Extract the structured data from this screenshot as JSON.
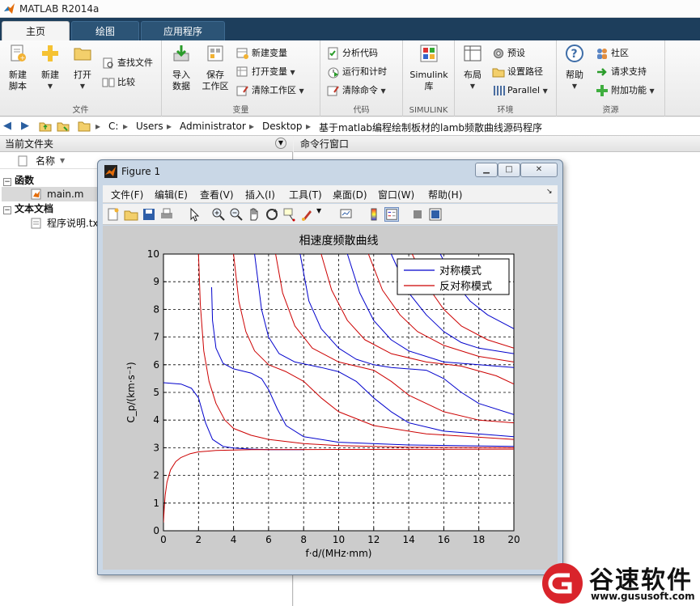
{
  "window": {
    "title": "MATLAB R2014a"
  },
  "tabs": [
    {
      "label": "主页",
      "active": true
    },
    {
      "label": "绘图",
      "active": false
    },
    {
      "label": "应用程序",
      "active": false
    }
  ],
  "ribbon": {
    "file": {
      "label": "文件",
      "new_script": "新建\n脚本",
      "new": "新建",
      "open": "打开",
      "find_files": "查找文件",
      "compare": "比较"
    },
    "variable": {
      "label": "变量",
      "import_data": "导入\n数据",
      "save_workspace": "保存\n工作区",
      "new_variable": "新建变量",
      "open_variable": "打开变量",
      "clear_workspace": "清除工作区"
    },
    "code": {
      "label": "代码",
      "analyze_code": "分析代码",
      "run_and_time": "运行和计时",
      "clear_commands": "清除命令"
    },
    "simulink": {
      "label": "SIMULINK",
      "library": "Simulink\n库"
    },
    "environment": {
      "label": "环境",
      "layout": "布局",
      "preferences": "预设",
      "set_path": "设置路径",
      "parallel": "Parallel"
    },
    "resources": {
      "label": "资源",
      "help": "帮助",
      "community": "社区",
      "request_support": "请求支持",
      "addons": "附加功能"
    }
  },
  "address": {
    "segments": [
      "C:",
      "Users",
      "Administrator",
      "Desktop",
      "基于matlab编程绘制板材的lamb频散曲线源码程序"
    ]
  },
  "current_folder": {
    "title": "当前文件夹",
    "name_col": "名称",
    "groups": [
      {
        "label": "函数",
        "items": [
          "main.m"
        ]
      },
      {
        "label": "文本文档",
        "items": [
          "程序说明.txt"
        ]
      }
    ]
  },
  "command_window": {
    "title": "命令行窗口"
  },
  "figure": {
    "title": "Figure 1",
    "menu": [
      "文件(F)",
      "编辑(E)",
      "查看(V)",
      "插入(I)",
      "工具(T)",
      "桌面(D)",
      "窗口(W)",
      "帮助(H)"
    ]
  },
  "chart_data": {
    "type": "line",
    "title": "相速度频散曲线",
    "xlabel": "f·d/(MHz·mm)",
    "ylabel": "C_p/(km·s⁻¹)",
    "xlim": [
      0,
      20
    ],
    "ylim": [
      0,
      10
    ],
    "xticks": [
      0,
      2,
      4,
      6,
      8,
      10,
      12,
      14,
      16,
      18,
      20
    ],
    "yticks": [
      0,
      1,
      2,
      3,
      4,
      5,
      6,
      7,
      8,
      9,
      10
    ],
    "grid": true,
    "legend": {
      "position": "top-right",
      "entries": [
        {
          "name": "对称模式",
          "color": "#0000cc"
        },
        {
          "name": "反对称模式",
          "color": "#cc0000"
        }
      ]
    },
    "series": [
      {
        "name": "对称模式",
        "mode": "S0",
        "color": "#0000cc",
        "points": [
          [
            0,
            5.35
          ],
          [
            1,
            5.3
          ],
          [
            1.6,
            5.15
          ],
          [
            2,
            4.8
          ],
          [
            2.4,
            3.9
          ],
          [
            2.8,
            3.3
          ],
          [
            3.4,
            3.05
          ],
          [
            4,
            2.99
          ],
          [
            5,
            2.95
          ],
          [
            6,
            2.93
          ],
          [
            7,
            2.93
          ],
          [
            8,
            2.93
          ]
        ]
      },
      {
        "name": "对称模式",
        "mode": "S1",
        "color": "#0000cc",
        "points": [
          [
            2.75,
            8.8
          ],
          [
            2.8,
            7.6
          ],
          [
            3,
            6.6
          ],
          [
            3.4,
            6.05
          ],
          [
            4,
            5.85
          ],
          [
            5,
            5.7
          ],
          [
            5.6,
            5.5
          ],
          [
            6,
            5.1
          ],
          [
            6.5,
            4.4
          ],
          [
            7,
            3.8
          ],
          [
            8,
            3.4
          ],
          [
            10,
            3.2
          ],
          [
            14,
            3.1
          ],
          [
            20,
            3.05
          ]
        ]
      },
      {
        "name": "对称模式",
        "mode": "S2",
        "color": "#0000cc",
        "points": [
          [
            5.2,
            10
          ],
          [
            5.6,
            8.0
          ],
          [
            6,
            7.0
          ],
          [
            6.6,
            6.4
          ],
          [
            7.5,
            6.1
          ],
          [
            9,
            5.9
          ],
          [
            10,
            5.75
          ],
          [
            11,
            5.4
          ],
          [
            12,
            4.8
          ],
          [
            13,
            4.3
          ],
          [
            14,
            3.9
          ],
          [
            16,
            3.6
          ],
          [
            20,
            3.4
          ]
        ]
      },
      {
        "name": "对称模式",
        "mode": "S3",
        "color": "#0000cc",
        "points": [
          [
            7.8,
            10
          ],
          [
            8.3,
            8.3
          ],
          [
            9,
            7.3
          ],
          [
            10,
            6.6
          ],
          [
            11,
            6.2
          ],
          [
            12,
            6.0
          ],
          [
            13,
            5.9
          ],
          [
            15,
            5.8
          ],
          [
            16,
            5.5
          ],
          [
            17,
            5.0
          ],
          [
            18,
            4.6
          ],
          [
            20,
            4.2
          ]
        ]
      },
      {
        "name": "对称模式",
        "mode": "S4",
        "color": "#0000cc",
        "points": [
          [
            10.5,
            10
          ],
          [
            11.2,
            8.6
          ],
          [
            12,
            7.6
          ],
          [
            13,
            6.9
          ],
          [
            14,
            6.5
          ],
          [
            16,
            6.1
          ],
          [
            18,
            6.0
          ],
          [
            20,
            5.9
          ]
        ]
      },
      {
        "name": "对称模式",
        "mode": "S5",
        "color": "#0000cc",
        "points": [
          [
            13,
            10
          ],
          [
            14,
            8.6
          ],
          [
            15,
            7.8
          ],
          [
            16,
            7.2
          ],
          [
            17,
            6.8
          ],
          [
            18,
            6.6
          ],
          [
            20,
            6.4
          ]
        ]
      },
      {
        "name": "对称模式",
        "mode": "S6",
        "color": "#0000cc",
        "points": [
          [
            15.8,
            10
          ],
          [
            16.6,
            9.0
          ],
          [
            17.5,
            8.3
          ],
          [
            18.5,
            7.8
          ],
          [
            20,
            7.3
          ]
        ]
      },
      {
        "name": "反对称模式",
        "mode": "A0",
        "color": "#cc0000",
        "points": [
          [
            0,
            0.3
          ],
          [
            0.05,
            0.9
          ],
          [
            0.1,
            1.3
          ],
          [
            0.2,
            1.75
          ],
          [
            0.4,
            2.2
          ],
          [
            0.7,
            2.5
          ],
          [
            1,
            2.65
          ],
          [
            1.5,
            2.78
          ],
          [
            2,
            2.85
          ],
          [
            3,
            2.9
          ],
          [
            5,
            2.93
          ],
          [
            10,
            2.94
          ],
          [
            20,
            2.95
          ]
        ]
      },
      {
        "name": "反对称模式",
        "mode": "A1",
        "color": "#cc0000",
        "points": [
          [
            2,
            10
          ],
          [
            2.1,
            8.2
          ],
          [
            2.3,
            6.5
          ],
          [
            2.6,
            5.4
          ],
          [
            3,
            4.6
          ],
          [
            3.5,
            4.0
          ],
          [
            4,
            3.7
          ],
          [
            5,
            3.45
          ],
          [
            6,
            3.3
          ],
          [
            8,
            3.15
          ],
          [
            10,
            3.08
          ],
          [
            14,
            3.02
          ],
          [
            20,
            3.0
          ]
        ]
      },
      {
        "name": "反对称模式",
        "mode": "A2",
        "color": "#cc0000",
        "points": [
          [
            4,
            10
          ],
          [
            4.3,
            8.3
          ],
          [
            4.7,
            7.2
          ],
          [
            5.2,
            6.5
          ],
          [
            6,
            6.0
          ],
          [
            7,
            5.75
          ],
          [
            8,
            5.4
          ],
          [
            9,
            4.8
          ],
          [
            10,
            4.3
          ],
          [
            12,
            3.8
          ],
          [
            15,
            3.5
          ],
          [
            20,
            3.3
          ]
        ]
      },
      {
        "name": "反对称模式",
        "mode": "A3",
        "color": "#cc0000",
        "points": [
          [
            6.4,
            10
          ],
          [
            6.8,
            8.6
          ],
          [
            7.5,
            7.4
          ],
          [
            8.5,
            6.6
          ],
          [
            10,
            6.1
          ],
          [
            11,
            5.95
          ],
          [
            12,
            5.8
          ],
          [
            13,
            5.4
          ],
          [
            14,
            4.9
          ],
          [
            16,
            4.3
          ],
          [
            18,
            4.0
          ],
          [
            20,
            3.9
          ]
        ]
      },
      {
        "name": "反对称模式",
        "mode": "A4",
        "color": "#cc0000",
        "points": [
          [
            9,
            10
          ],
          [
            9.6,
            8.7
          ],
          [
            10.5,
            7.6
          ],
          [
            11.5,
            6.9
          ],
          [
            13,
            6.4
          ],
          [
            15,
            6.1
          ],
          [
            17,
            5.95
          ],
          [
            19,
            5.6
          ],
          [
            20,
            5.3
          ]
        ]
      },
      {
        "name": "反对称模式",
        "mode": "A5",
        "color": "#cc0000",
        "points": [
          [
            11.7,
            10
          ],
          [
            12.5,
            8.7
          ],
          [
            13.5,
            7.8
          ],
          [
            14.5,
            7.2
          ],
          [
            16,
            6.7
          ],
          [
            18,
            6.3
          ],
          [
            20,
            6.1
          ]
        ]
      },
      {
        "name": "反对称模式",
        "mode": "A6",
        "color": "#cc0000",
        "points": [
          [
            14.2,
            10
          ],
          [
            15,
            8.9
          ],
          [
            16,
            8.0
          ],
          [
            17,
            7.4
          ],
          [
            18.5,
            6.9
          ],
          [
            20,
            6.6
          ]
        ]
      }
    ]
  },
  "watermark": {
    "brand": "谷速软件",
    "url": "www.gususoft.com"
  }
}
